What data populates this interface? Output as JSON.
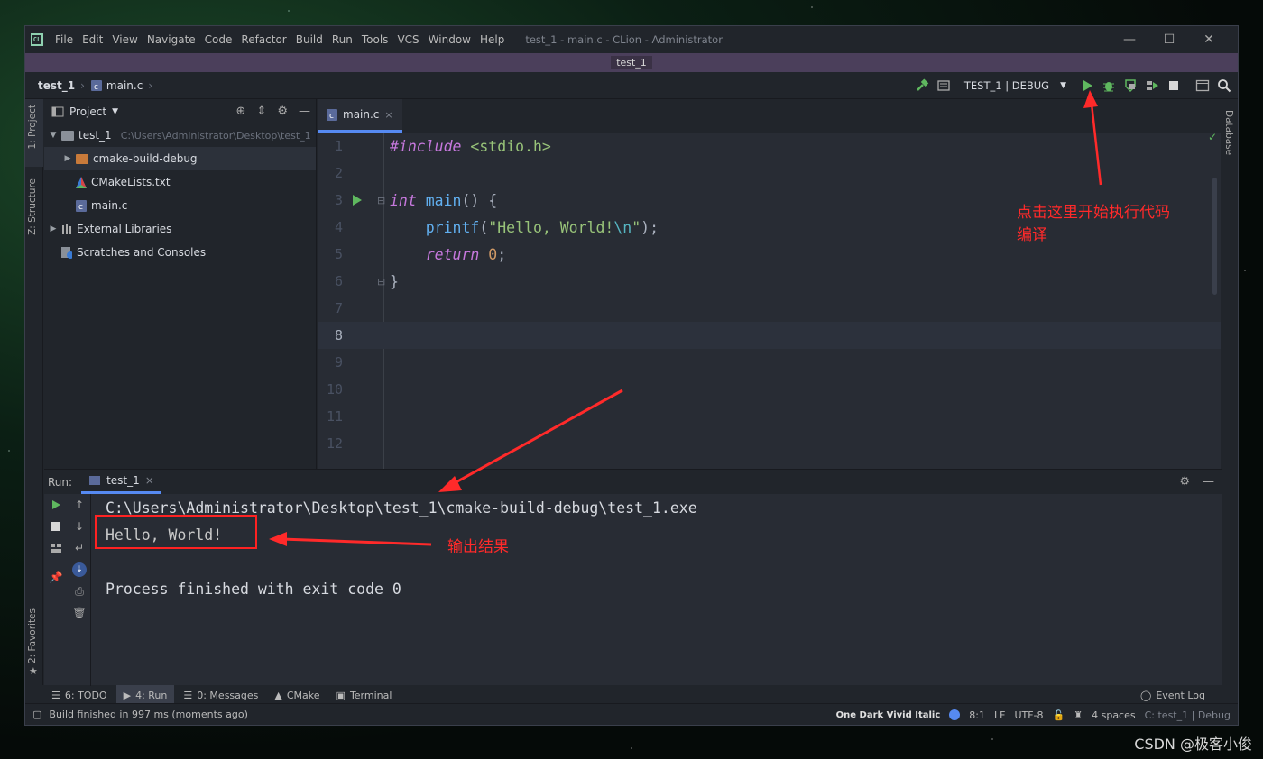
{
  "window": {
    "title": "test_1 - main.c - CLion - Administrator",
    "project_band": "test_1",
    "logo_text": "CL"
  },
  "menu": [
    {
      "label": "File"
    },
    {
      "label": "Edit"
    },
    {
      "label": "View"
    },
    {
      "label": "Navigate"
    },
    {
      "label": "Code"
    },
    {
      "label": "Refactor"
    },
    {
      "label": "Build"
    },
    {
      "label": "Run"
    },
    {
      "label": "Tools"
    },
    {
      "label": "VCS"
    },
    {
      "label": "Window"
    },
    {
      "label": "Help"
    }
  ],
  "window_controls": {
    "minimize": "—",
    "maximize": "☐",
    "close": "✕"
  },
  "breadcrumb": {
    "project": "test_1",
    "file": "main.c",
    "sep": "›"
  },
  "toolbar": {
    "run_config": "TEST_1 | DEBUG",
    "dropdown": "▼",
    "build_icon": "hammer-icon",
    "run_icon": "play-icon",
    "debug_icon": "bug-icon",
    "stop_icon": "stop-icon",
    "search_icon": "search-icon"
  },
  "colors": {
    "run_green": "#5fb85f",
    "accent_blue": "#568af2",
    "annotation_red": "#ff2a2a",
    "band_purple": "#4b3f5b"
  },
  "left_stripe": {
    "project": "1: Project",
    "structure": "Z: Structure",
    "favorites": "2: Favorites"
  },
  "right_stripe": {
    "database": "Database"
  },
  "project_panel": {
    "header": "Project",
    "tree": [
      {
        "label": "test_1",
        "path": "C:\\Users\\Administrator\\Desktop\\test_1",
        "type": "folder",
        "expanded": true
      },
      {
        "label": "cmake-build-debug",
        "type": "folder",
        "expanded": false
      },
      {
        "label": "CMakeLists.txt",
        "type": "cmake"
      },
      {
        "label": "main.c",
        "type": "c-file"
      },
      {
        "label": "External Libraries",
        "type": "library"
      },
      {
        "label": "Scratches and Consoles",
        "type": "scratch"
      }
    ]
  },
  "editor": {
    "tab_label": "main.c",
    "tab_close": "×",
    "line_numbers": [
      "1",
      "2",
      "3",
      "4",
      "5",
      "6",
      "7",
      "8",
      "9",
      "10",
      "11",
      "12"
    ],
    "code": {
      "l1_a": "#include",
      "l1_b": " <stdio.h>",
      "l3_a": "int",
      "l3_b": " main",
      "l3_c": "() {",
      "l4_a": "    printf",
      "l4_b": "(",
      "l4_c": "\"Hello, World!",
      "l4_d": "\\n",
      "l4_e": "\"",
      "l4_f": ");",
      "l5_a": "    return",
      "l5_b": " ",
      "l5_c": "0",
      "l5_d": ";",
      "l6_a": "}"
    },
    "current_line": 8
  },
  "run_panel": {
    "label": "Run:",
    "tab": "test_1",
    "tab_close": "×",
    "console": [
      "C:\\Users\\Administrator\\Desktop\\test_1\\cmake-build-debug\\test_1.exe",
      "Hello, World!",
      "",
      "Process finished with exit code 0"
    ]
  },
  "bottom_tabs": [
    {
      "prefix": "6",
      "label": ": TODO",
      "icon": "list-icon"
    },
    {
      "prefix": "4",
      "label": ": Run",
      "icon": "play-icon"
    },
    {
      "prefix": "0",
      "label": ": Messages",
      "icon": "message-icon"
    },
    {
      "prefix": "",
      "label": "CMake",
      "icon": "cmake-icon"
    },
    {
      "prefix": "",
      "label": "Terminal",
      "icon": "terminal-icon"
    }
  ],
  "event_log": "Event Log",
  "status": {
    "message": "Build finished in 997 ms (moments ago)",
    "theme": "One Dark Vivid Italic",
    "position": "8:1",
    "line_sep": "LF",
    "encoding": "UTF-8",
    "indent": "4 spaces",
    "context": "C: test_1 | Debug"
  },
  "annotations": {
    "run_hint_line1": "点击这里开始执行代码",
    "run_hint_line2": "编译",
    "output_label": "输出结果"
  },
  "watermark": "CSDN @极客小俊"
}
